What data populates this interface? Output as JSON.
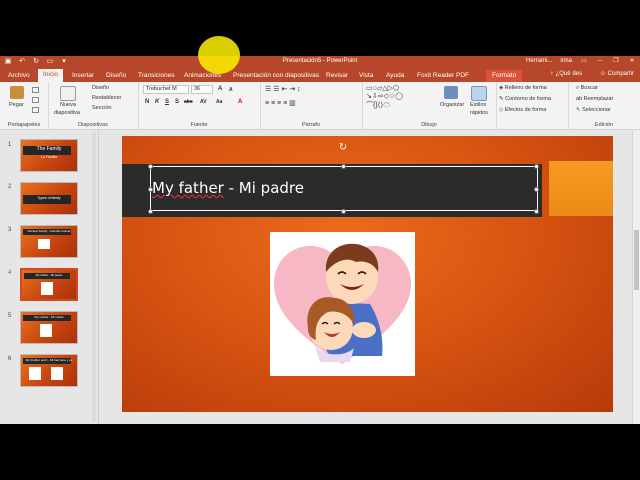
{
  "window": {
    "title": "Presentación5 - PowerPoint",
    "user_label": "Herrami...",
    "user_name": "irma"
  },
  "tabs": [
    {
      "label": "Archivo",
      "active": false
    },
    {
      "label": "Inicio",
      "active": true
    },
    {
      "label": "Insertar",
      "active": false
    },
    {
      "label": "Diseño",
      "active": false
    },
    {
      "label": "Transiciones",
      "active": false
    },
    {
      "label": "Animaciones",
      "active": false
    },
    {
      "label": "Presentación con diapositivas",
      "active": false
    },
    {
      "label": "Revisar",
      "active": false
    },
    {
      "label": "Vista",
      "active": false
    },
    {
      "label": "Ayuda",
      "active": false
    },
    {
      "label": "Foxit Reader PDF",
      "active": false
    },
    {
      "label": "Formato",
      "active": false,
      "contextual": true
    }
  ],
  "tell_me": "¿Qué des",
  "share": "Compartir",
  "ribbon": {
    "clipboard": {
      "paste": "Pegar",
      "label": "Portapapeles"
    },
    "slides": {
      "new_slide_1": "Nueva",
      "new_slide_2": "diapositiva",
      "layout": "Diseño",
      "reset": "Restablecer",
      "section": "Sección",
      "label": "Diapositivas"
    },
    "font": {
      "name": "Trebuchet M",
      "size": "36",
      "label": "Fuente",
      "bold": "N",
      "italic": "K",
      "underline": "S",
      "shadow": "S",
      "strike": "abc",
      "spacing": "AV",
      "case": "Aa",
      "grow": "A",
      "shrink": "A"
    },
    "paragraph": {
      "label": "Párrafo"
    },
    "drawing": {
      "label": "Dibujo",
      "arrange": "Organizar",
      "styles_1": "Estilos",
      "styles_2": "rápidos",
      "fill": "Relleno de forma",
      "outline": "Contorno de forma",
      "effects": "Efectos de forma"
    },
    "editing": {
      "label": "Edición",
      "find": "Buscar",
      "replace": "Reemplazar",
      "select": "Seleccionar"
    }
  },
  "thumbnails": [
    {
      "num": "1",
      "title": "The Family",
      "subtitle": "La Familia"
    },
    {
      "num": "2",
      "title": "Types of family"
    },
    {
      "num": "3",
      "title": "Nuclear Family - Familia nuclear"
    },
    {
      "num": "4",
      "title": "My father - Mi padre",
      "selected": true
    },
    {
      "num": "5",
      "title": "My mother - Mi madre"
    },
    {
      "num": "6",
      "title": "My brother and I - Mi hermano y yo"
    }
  ],
  "slide": {
    "title_part1": "My father",
    "title_part2": " - Mi padre"
  },
  "colors": {
    "accent": "#b7472a",
    "slide_orange": "#d95512",
    "title_band": "#2b2b2b"
  }
}
